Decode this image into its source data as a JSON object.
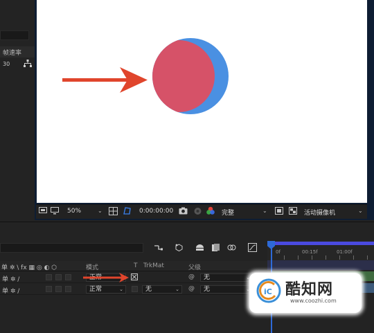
{
  "project_panel": {
    "column_header": "帧速率",
    "fps_value": "30",
    "flow_icon": "flowchart-icon"
  },
  "viewer": {
    "magnification": "50%",
    "timecode": "0:00:00:00",
    "resolution": "完整",
    "camera": "活动摄像机",
    "colors": {
      "canvas": "#ffffff",
      "circle_blue": "#4a90e2",
      "circle_red": "#d65268",
      "arrow": "#e0452c",
      "border": "#2e5d9a"
    },
    "icons": [
      "comp-region-icon",
      "monitor-icon",
      "grid-icon",
      "mask-icon",
      "snapshot-icon",
      "show-snapshot-icon",
      "color-channels-icon",
      "fast-preview-icon",
      "transparency-grid-icon"
    ]
  },
  "timeline": {
    "toolbar_icons": [
      "comp-flowchart-icon",
      "draft-3d-icon",
      "shy-layers-icon",
      "frame-blending-icon",
      "motion-blur-icon",
      "graph-editor-icon"
    ],
    "ruler_labels": [
      "0f",
      "00:15f",
      "01:00f"
    ],
    "columns": {
      "mode": "模式",
      "t": "T",
      "trkmat": "TrkMat",
      "parent": "父级"
    },
    "switch_header": "单 ✲ \\ fx ▦ ◎ ◐ ⬡",
    "layers": [
      {
        "switches": "单 ✲ /",
        "mode": "正常",
        "trkmat": "",
        "parent": "无"
      },
      {
        "switches": "单 ✲ /",
        "mode": "正常",
        "trkmat": "无",
        "parent": "无"
      }
    ]
  },
  "watermark": {
    "name": "酷知网",
    "url": "www.coozhi.com"
  }
}
